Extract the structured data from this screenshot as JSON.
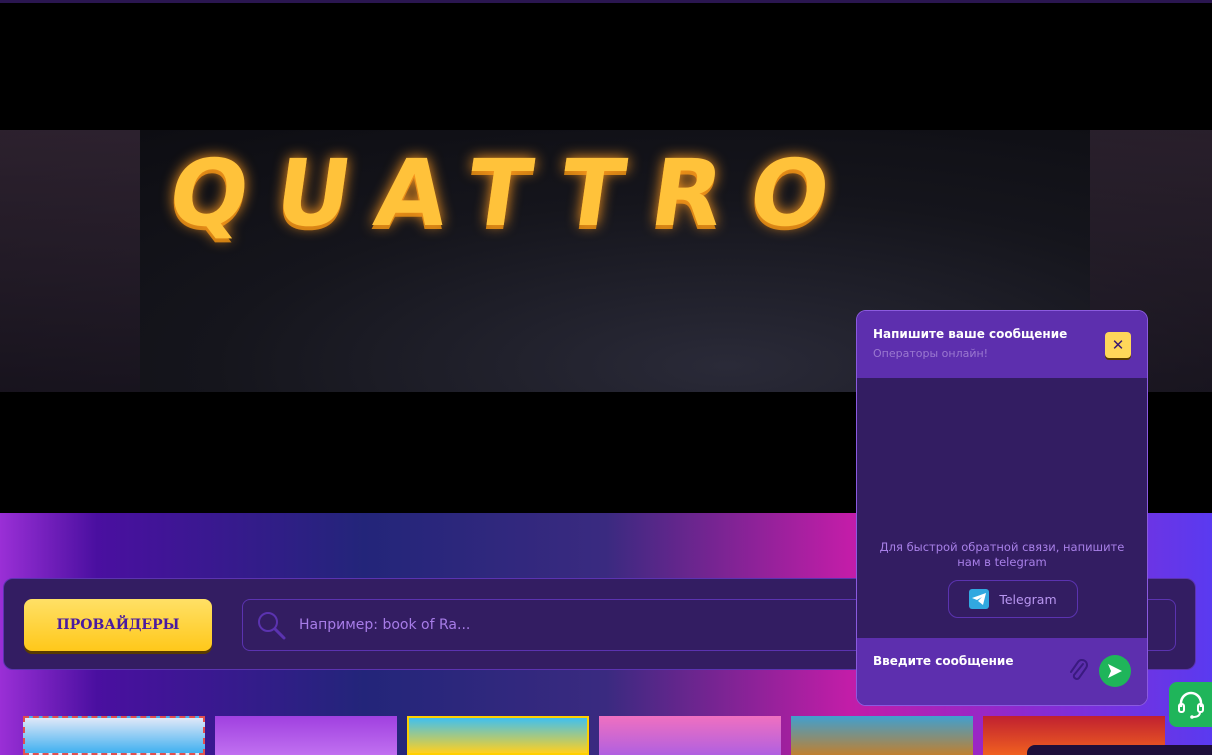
{
  "banner": {
    "logo_text": "QUATTRO"
  },
  "filter": {
    "providers_label": "ПРОВАЙДЕРЫ",
    "search_placeholder": "Например: book of Ra..."
  },
  "chat": {
    "title": "Напишите ваше сообщение",
    "subtitle": "Операторы онлайн!",
    "feedback_text": "Для быстрой обратной связи, напишите нам в telegram",
    "telegram_label": "Telegram",
    "message_placeholder": "Введите сообщение"
  },
  "colors": {
    "accent": "#ffd75a",
    "panel": "#331d62",
    "header": "#5d2fae",
    "green": "#1fb55a"
  }
}
